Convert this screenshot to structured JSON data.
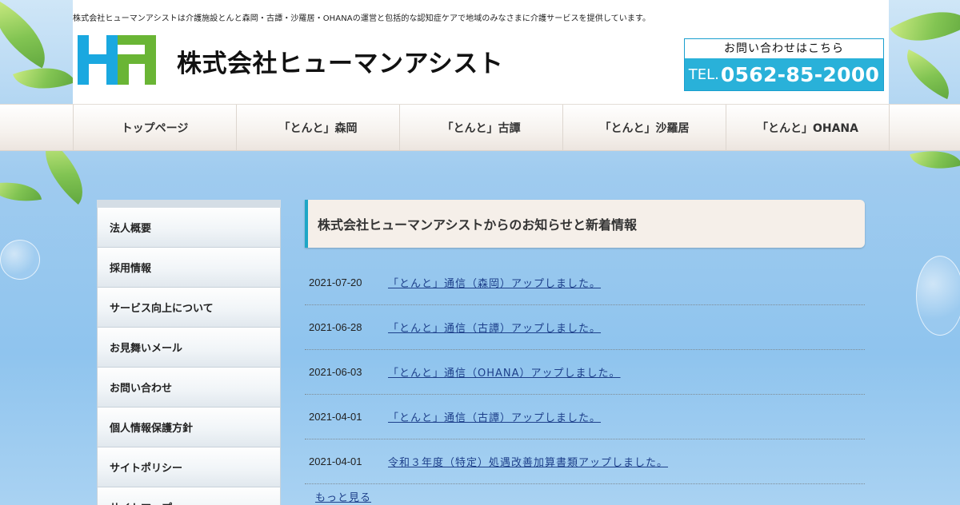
{
  "header": {
    "tagline": "株式会社ヒューマンアシストは介護施設とんと森岡・古譚・沙羅居・OHANAの運営と包括的な認知症ケアで地域のみなさまに介護サービスを提供しています。",
    "logo_text": "株式会社ヒューマンアシスト",
    "contact_label": "お問い合わせはこちら",
    "tel_label": "TEL.",
    "tel_number": "0562-85-2000"
  },
  "nav": {
    "items": [
      "トップページ",
      "「とんと」森岡",
      "「とんと」古譚",
      "「とんと」沙羅居",
      "「とんと」OHANA"
    ]
  },
  "sidebar": {
    "items": [
      "法人概要",
      "採用情報",
      "サービス向上について",
      "お見舞いメール",
      "お問い合わせ",
      "個人情報保護方針",
      "サイトポリシー",
      "サイトマップ"
    ]
  },
  "news": {
    "title": "株式会社ヒューマンアシストからのお知らせと新着情報",
    "items": [
      {
        "date": "2021-07-20",
        "text": "「とんと」通信（森岡）アップしました。"
      },
      {
        "date": "2021-06-28",
        "text": "「とんと」通信（古譚）アップしました。"
      },
      {
        "date": "2021-06-03",
        "text": "「とんと」通信（OHANA）アップしました。"
      },
      {
        "date": "2021-04-01",
        "text": "「とんと」通信（古譚）アップしました。"
      },
      {
        "date": "2021-04-01",
        "text": "令和３年度（特定）処遇改善加算書類アップしました。"
      }
    ],
    "more": "もっと見る"
  },
  "colors": {
    "accent": "#29b1d9",
    "link": "#1d3f8a",
    "logo_blue": "#1aa8e0",
    "logo_green": "#6ab535"
  }
}
